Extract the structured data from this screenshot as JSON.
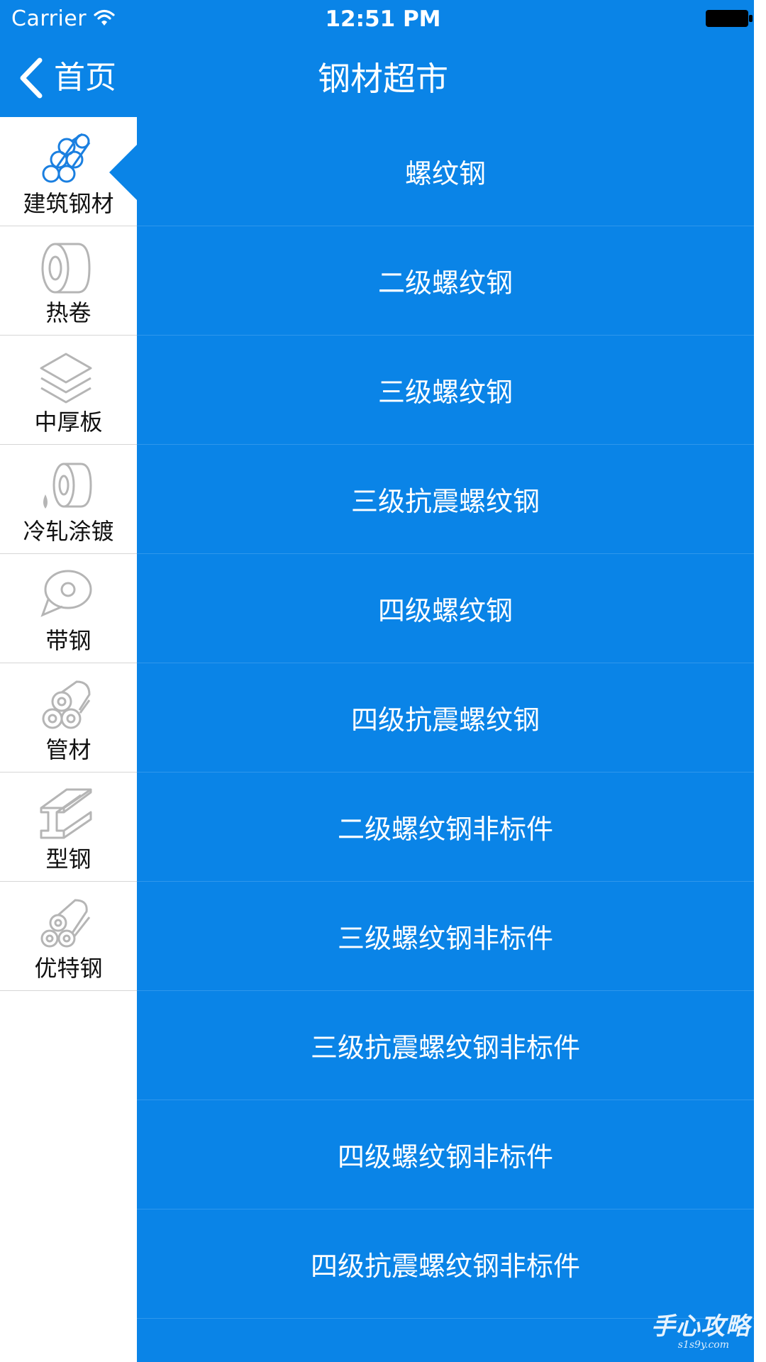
{
  "status_bar": {
    "carrier": "Carrier",
    "time": "12:51 PM"
  },
  "nav": {
    "back_label": "首页",
    "title": "钢材超市"
  },
  "colors": {
    "primary": "#0a84e7",
    "sidebar_bg": "#ffffff",
    "icon_active": "#1a7fe0",
    "icon_inactive": "#b5b5b5"
  },
  "sidebar": {
    "items": [
      {
        "label": "建筑钢材",
        "icon": "rebar-bundle-icon",
        "active": true
      },
      {
        "label": "热卷",
        "icon": "hot-coil-icon",
        "active": false
      },
      {
        "label": "中厚板",
        "icon": "stacked-plates-icon",
        "active": false
      },
      {
        "label": "冷轧涂镀",
        "icon": "cold-roll-coil-icon",
        "active": false
      },
      {
        "label": "带钢",
        "icon": "strip-coil-icon",
        "active": false
      },
      {
        "label": "管材",
        "icon": "pipe-bundle-icon",
        "active": false
      },
      {
        "label": "型钢",
        "icon": "i-beam-icon",
        "active": false
      },
      {
        "label": "优特钢",
        "icon": "special-steel-bars-icon",
        "active": false
      }
    ]
  },
  "main_list": {
    "items": [
      "螺纹钢",
      "二级螺纹钢",
      "三级螺纹钢",
      "三级抗震螺纹钢",
      "四级螺纹钢",
      "四级抗震螺纹钢",
      "二级螺纹钢非标件",
      "三级螺纹钢非标件",
      "三级抗震螺纹钢非标件",
      "四级螺纹钢非标件",
      "四级抗震螺纹钢非标件"
    ]
  },
  "watermark": {
    "text": "手心攻略",
    "sub": "s1s9y.com"
  }
}
